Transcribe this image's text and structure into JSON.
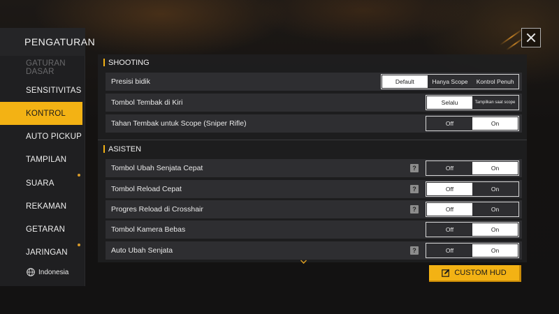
{
  "sidebar": {
    "title": "PENGATURAN",
    "items": [
      {
        "label": "GATURAN DASAR",
        "state": "faded"
      },
      {
        "label": "SENSITIVITAS",
        "state": "normal"
      },
      {
        "label": "KONTROL",
        "state": "active"
      },
      {
        "label": "AUTO PICKUP",
        "state": "normal"
      },
      {
        "label": "TAMPILAN",
        "state": "normal"
      },
      {
        "label": "SUARA",
        "state": "normal"
      },
      {
        "label": "REKAMAN",
        "state": "normal"
      },
      {
        "label": "GETARAN",
        "state": "normal"
      },
      {
        "label": "JARINGAN",
        "state": "partial"
      }
    ],
    "language": "Indonesia"
  },
  "sections": {
    "shooting": {
      "title": "SHOOTING",
      "rows": [
        {
          "label": "Presisi bidik",
          "options": [
            "Default",
            "Hanya Scope",
            "Kontrol Penuh"
          ],
          "selected": 0
        },
        {
          "label": "Tombol Tembak di Kiri",
          "options": [
            "Selalu",
            "Tampilkan saat scope"
          ],
          "selected": 0
        },
        {
          "label": "Tahan Tembak untuk Scope (Sniper Rifle)",
          "options": [
            "Off",
            "On"
          ],
          "selected": 1
        }
      ]
    },
    "asisten": {
      "title": "ASISTEN",
      "rows": [
        {
          "label": "Tombol Ubah Senjata Cepat",
          "options": [
            "Off",
            "On"
          ],
          "selected": 1,
          "help": "?"
        },
        {
          "label": "Tombol Reload Cepat",
          "options": [
            "Off",
            "On"
          ],
          "selected": 0,
          "help": "?"
        },
        {
          "label": "Progres Reload di Crosshair",
          "options": [
            "Off",
            "On"
          ],
          "selected": 0,
          "help": "?"
        },
        {
          "label": "Tombol Kamera Bebas",
          "options": [
            "Off",
            "On"
          ],
          "selected": 1
        },
        {
          "label": "Auto Ubah Senjata",
          "options": [
            "Off",
            "On"
          ],
          "selected": 1,
          "help": "?"
        }
      ]
    }
  },
  "custom_hud_label": "CUSTOM HUD",
  "colors": {
    "accent": "#f3b214",
    "panel": "#1e1e20",
    "row": "#2e2e31"
  }
}
